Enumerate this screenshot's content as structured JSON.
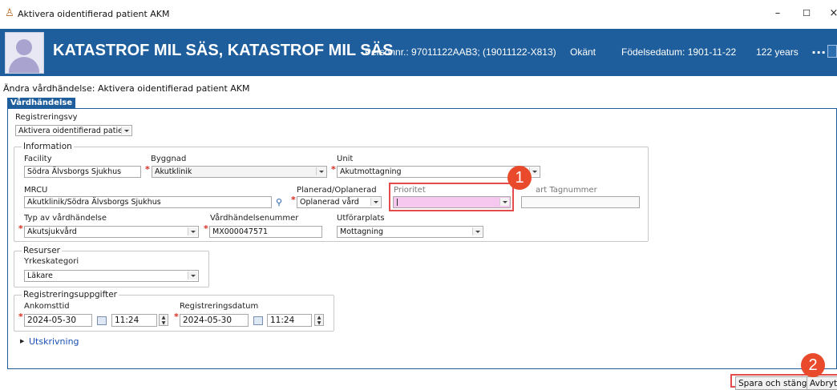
{
  "window": {
    "title": "Aktivera oidentifierad patient AKM",
    "icon": "person-alert-icon",
    "controls": {
      "minimize": "–",
      "maximize": "☐",
      "close": "×"
    }
  },
  "banner": {
    "name": "KATASTROF MIL SÄS, KATASTROF MIL SÄS",
    "personnr": "Personnr.: 97011122AAB3; (19011122-X813)",
    "gender": "Okänt",
    "birthdate_label": "Födelsedatum: 1901-11-22",
    "age": "122 years",
    "more": "..."
  },
  "heading": "Ändra vårdhändelse: Aktivera oidentifierad patient AKM",
  "tab_label": "Vårdhändelse",
  "registreringsvy": {
    "label": "Registreringsvy",
    "value": "Aktivera oidentifierad patien"
  },
  "information": {
    "legend": "Information",
    "facility": {
      "label": "Facility",
      "value": "Södra Älvsborgs Sjukhus"
    },
    "byggnad": {
      "label": "Byggnad",
      "value": "Akutklinik"
    },
    "unit": {
      "label": "Unit",
      "value": "Akutmottagning"
    },
    "mrcu": {
      "label": "MRCU",
      "value": "Akutklinik/Södra Älvsborgs Sjukhus"
    },
    "planerad": {
      "label": "Planerad/Oplanerad",
      "value": "Oplanerad vård"
    },
    "prioritet": {
      "label": "Prioritet",
      "value": ""
    },
    "tagnummer": {
      "label": "art Tagnummer",
      "value": ""
    },
    "typ": {
      "label": "Typ av vårdhändelse",
      "value": "Akutsjukvård"
    },
    "vardhandelsenummer": {
      "label": "Vårdhändelsenummer",
      "value": "MX000047571"
    },
    "utforarplats": {
      "label": "Utförarplats",
      "value": "Mottagning"
    }
  },
  "resurser": {
    "legend": "Resurser",
    "yrkeskategori": {
      "label": "Yrkeskategori",
      "value": "Läkare"
    }
  },
  "registreringsuppgifter": {
    "legend": "Registreringsuppgifter",
    "ankomsttid": {
      "label": "Ankomsttid",
      "date": "2024-05-30",
      "time": "11:24"
    },
    "registreringsdatum": {
      "label": "Registreringsdatum",
      "date": "2024-05-30",
      "time": "11:24"
    }
  },
  "utskrivning": "Utskrivning",
  "buttons": {
    "save_close": "Spara och stäng",
    "cancel": "Avbryt"
  },
  "callouts": {
    "one": "1",
    "two": "2"
  },
  "colors": {
    "banner": "#1e5e9c",
    "highlight": "#e44b4b",
    "callout": "#e84a2b",
    "required": "#d62d20",
    "prioritet_bg": "#f6c8f0"
  }
}
